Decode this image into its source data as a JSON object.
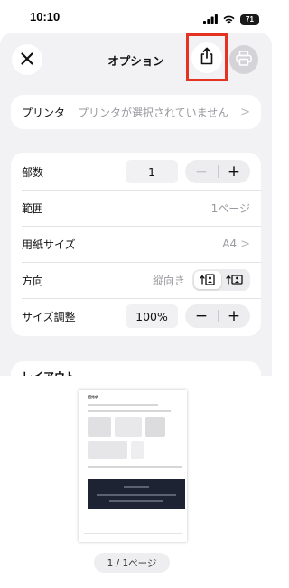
{
  "status_bar": {
    "time": "10:10",
    "battery": "71",
    "signal_icon": "cellular-signal-icon",
    "wifi_icon": "wifi-icon"
  },
  "nav": {
    "title": "オプション",
    "close_icon": "close-icon",
    "share_icon": "share-icon",
    "print_icon": "printer-icon",
    "highlight_color": "#e53323"
  },
  "printer": {
    "label": "プリンタ",
    "value": "プリンタが選択されていません",
    "chevron": ">"
  },
  "settings": {
    "copies": {
      "label": "部数",
      "value": "1",
      "minus": "−",
      "plus": "+"
    },
    "range": {
      "label": "範囲",
      "value": "1ページ"
    },
    "paper_size": {
      "label": "用紙サイズ",
      "value": "A4",
      "chevron": ">"
    },
    "orientation": {
      "label": "方向",
      "value": "縦向き",
      "selected": "portrait"
    },
    "scale": {
      "label": "サイズ調整",
      "value": "100%",
      "minus": "−",
      "plus": "+"
    }
  },
  "layout": {
    "title": "レイアウト"
  },
  "preview": {
    "doc_title": "招待状",
    "page_indicator": "1 / 1ページ"
  }
}
